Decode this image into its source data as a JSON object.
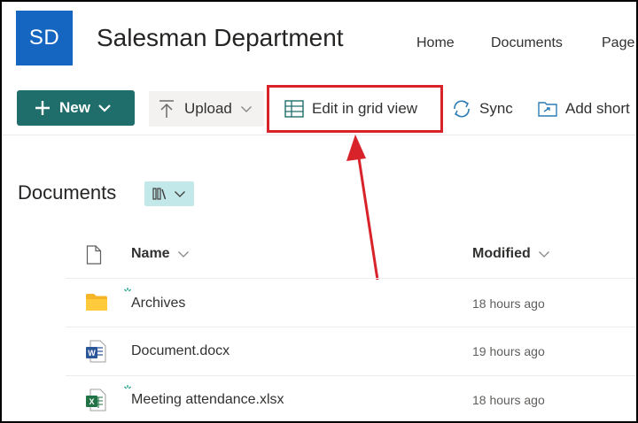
{
  "site": {
    "logo_initials": "SD",
    "title": "Salesman Department",
    "nav": [
      "Home",
      "Documents",
      "Page"
    ]
  },
  "command_bar": {
    "new_label": "New",
    "upload_label": "Upload",
    "edit_grid_label": "Edit in grid view",
    "sync_label": "Sync",
    "add_shortcut_label": "Add short"
  },
  "library": {
    "title": "Documents",
    "columns": {
      "name": "Name",
      "modified": "Modified"
    },
    "files": [
      {
        "name": "Archives",
        "modified": "18 hours ago",
        "type": "folder",
        "new": true
      },
      {
        "name": "Document.docx",
        "modified": "19 hours ago",
        "type": "word",
        "new": false
      },
      {
        "name": "Meeting attendance.xlsx",
        "modified": "18 hours ago",
        "type": "excel",
        "new": true
      }
    ]
  },
  "annotation": {
    "color": "#d8232a"
  },
  "colors": {
    "brand": "#1566c0",
    "new_button": "#1f6e6b",
    "view_switch": "#c3e8ea"
  }
}
